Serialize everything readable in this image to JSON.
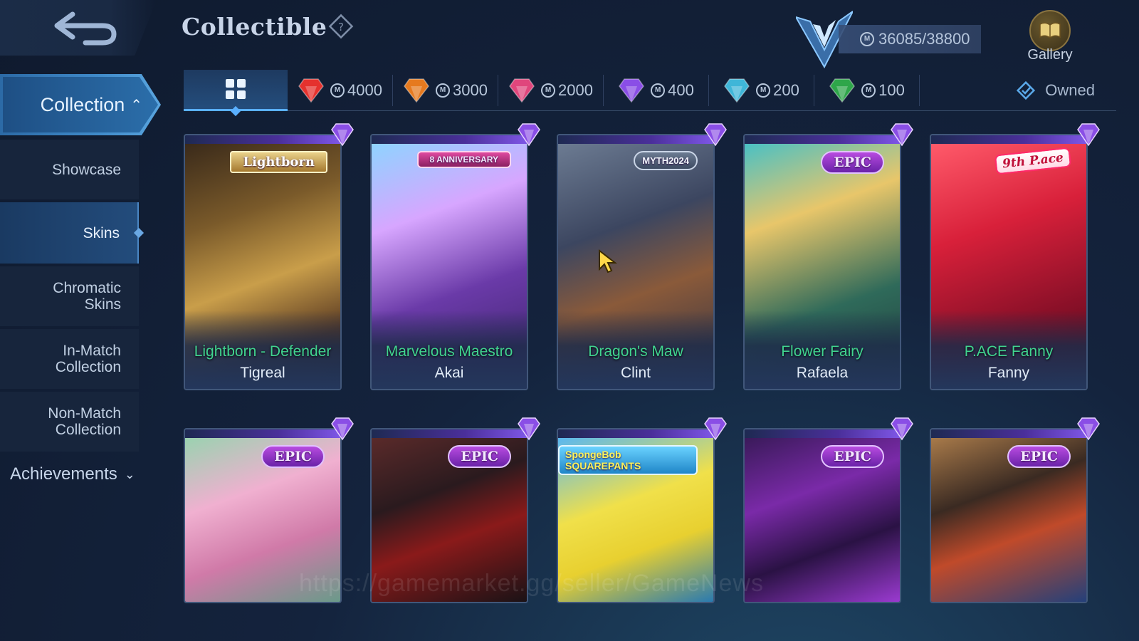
{
  "header": {
    "title": "Collectible",
    "points": "36085/38800",
    "gallery_label": "Gallery"
  },
  "sidebar": {
    "collection_label": "Collection",
    "items": [
      {
        "label": "Showcase"
      },
      {
        "label": "Skins"
      },
      {
        "label": "Chromatic Skins"
      },
      {
        "label": "In-Match Collection"
      },
      {
        "label": "Non-Match Collection"
      }
    ],
    "achievements_label": "Achievements"
  },
  "tabs": [
    {
      "value": "4000",
      "gem_color": "#e5322e"
    },
    {
      "value": "3000",
      "gem_color": "#e67a1f"
    },
    {
      "value": "2000",
      "gem_color": "#e0467c"
    },
    {
      "value": "400",
      "gem_color": "#8a4ee6"
    },
    {
      "value": "200",
      "gem_color": "#3fb6d8"
    },
    {
      "value": "100",
      "gem_color": "#2ea64a"
    }
  ],
  "owned_label": "Owned",
  "cards_row1": [
    {
      "skin": "Lightborn - Defender",
      "hero": "Tigreal",
      "badge": "Lightborn",
      "art": "linear-gradient(160deg,#3a2a1a 0%,#7a5a2a 30%,#c99e4a 55%,#5a3a22 80%,#2a1c12 100%)"
    },
    {
      "skin": "Marvelous Maestro",
      "hero": "Akai",
      "badge": "8 ANNIVERSARY",
      "art": "linear-gradient(160deg,#8fd3ff 0%,#d7a6ff 30%,#6a3aa8 60%,#3a2266 100%)"
    },
    {
      "skin": "Dragon's Maw",
      "hero": "Clint",
      "badge": "MYTH2024",
      "art": "linear-gradient(160deg,#6c7b92 0%,#3c4660 35%,#8a5a3a 60%,#2c2f44 100%)"
    },
    {
      "skin": "Flower Fairy",
      "hero": "Rafaela",
      "badge": "EPIC",
      "art": "linear-gradient(160deg,#4ac0c4 0%,#e8c66a 30%,#2f6a5a 65%,#1f3a3a 100%)"
    },
    {
      "skin": "P.ACE Fanny",
      "hero": "Fanny",
      "badge": "9th P.ace",
      "art": "linear-gradient(160deg,#ff5a6a 0%,#d8203a 35%,#8a1028 70%,#4a0818 100%)"
    }
  ],
  "cards_row2": [
    {
      "badge": "EPIC",
      "art": "linear-gradient(160deg,#9ad2b0 0%,#f0b0d0 35%,#d07aa8 65%,#6a9a8a 100%)"
    },
    {
      "badge": "EPIC",
      "art": "linear-gradient(160deg,#5a2a2a 0%,#2a1a1e 35%,#8a1a1a 60%,#1a1216 100%)"
    },
    {
      "badge": "SpongeBob SQUAREPANTS",
      "art": "linear-gradient(160deg,#5ab8f0 0%,#f0e04a 40%,#e8d030 65%,#2a7ab0 100%)"
    },
    {
      "badge": "EPIC",
      "art": "linear-gradient(160deg,#3a1a5a 0%,#7a2aa8 35%,#2a1244 65%,#9a3ad0 100%)"
    },
    {
      "badge": "EPIC",
      "art": "linear-gradient(160deg,#a87a4a 0%,#3a2a22 35%,#c04a2a 60%,#24407a 100%)"
    }
  ],
  "watermark": "https://gamemarket.gg/seller/GameNews"
}
